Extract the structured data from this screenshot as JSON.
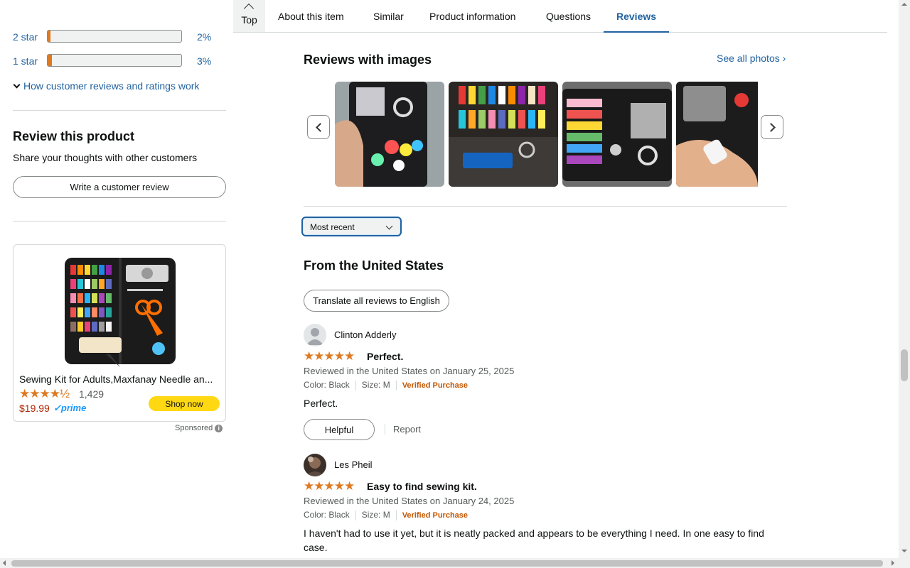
{
  "nav": {
    "top_label": "Top",
    "items": [
      "About this item",
      "Similar",
      "Product information",
      "Questions",
      "Reviews"
    ]
  },
  "ratings": [
    {
      "label": "2 star",
      "percent_text": "2%",
      "fill": 0.02
    },
    {
      "label": "1 star",
      "percent_text": "3%",
      "fill": 0.03
    }
  ],
  "how_link": "How customer reviews and ratings work",
  "review_product": {
    "title": "Review this product",
    "subtitle": "Share your thoughts with other customers",
    "button": "Write a customer review"
  },
  "ad": {
    "title": "Sewing Kit for Adults,Maxfanay Needle an...",
    "stars": "★★★★½",
    "rating_count": "1,429",
    "price": "$19.99",
    "prime": "✓prime",
    "button": "Shop now",
    "sponsored": "Sponsored"
  },
  "images_section": {
    "title": "Reviews with images",
    "see_all": "See all photos ›"
  },
  "sort": {
    "selected": "Most recent"
  },
  "region_title": "From the United States",
  "translate_button": "Translate all reviews to English",
  "reviews": [
    {
      "name": "Clinton Adderly",
      "stars": "★★★★★",
      "title": "Perfect.",
      "date": "Reviewed in the United States on January 25, 2025",
      "color": "Color: Black",
      "size": "Size: M",
      "verified": "Verified Purchase",
      "body": "Perfect.",
      "helpful": "Helpful",
      "report": "Report"
    },
    {
      "name": "Les Pheil",
      "stars": "★★★★★",
      "title": "Easy to find sewing kit.",
      "date": "Reviewed in the United States on January 24, 2025",
      "color": "Color: Black",
      "size": "Size: M",
      "verified": "Verified Purchase",
      "body": "I haven't had to use it yet, but it is neatly packed and appears to be everything I need. In one easy to find case."
    }
  ],
  "colors": {
    "accent": "#2162a1",
    "star": "#de7921",
    "price": "#b12704",
    "verified": "#c45500",
    "button_yellow": "#ffd814"
  }
}
